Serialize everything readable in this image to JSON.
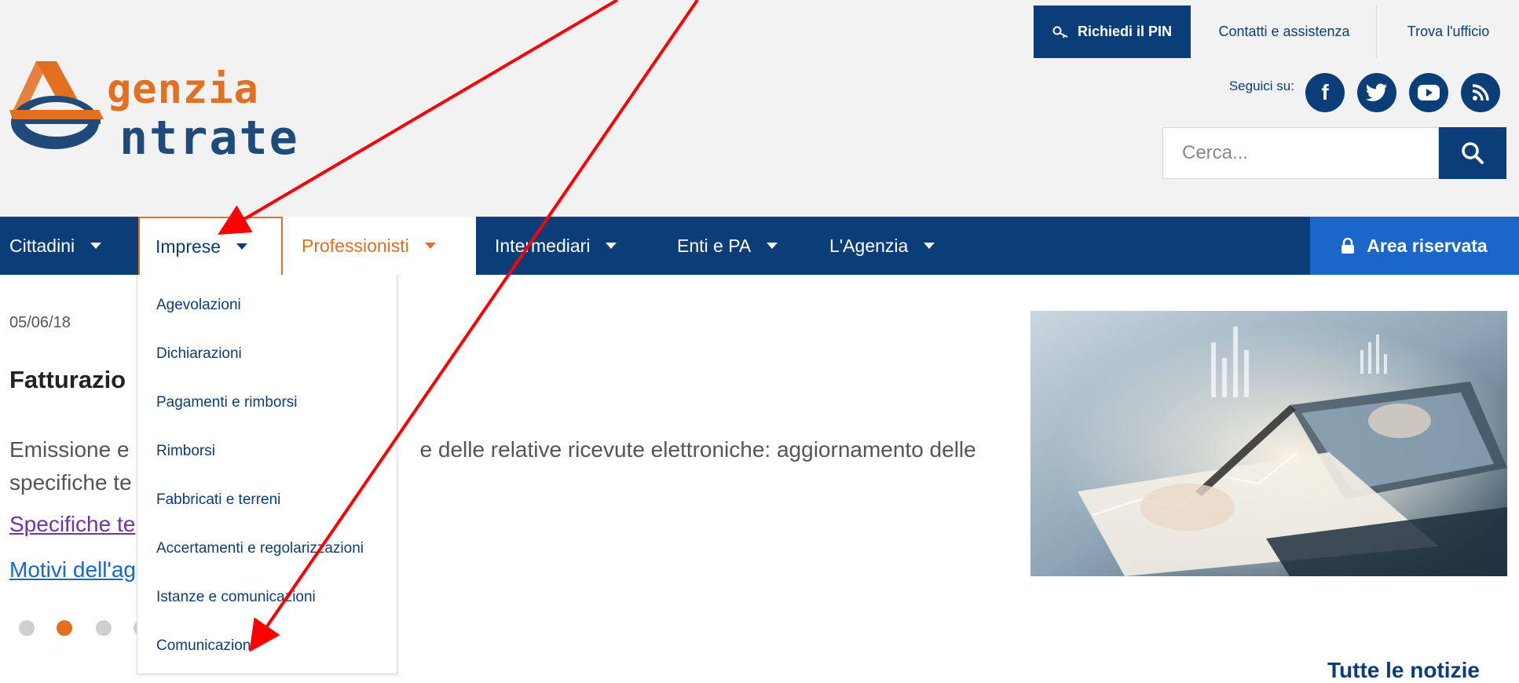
{
  "logo": {
    "line1": "genzia",
    "line2": "ntrate"
  },
  "top_bar": {
    "pin_label": "Richiedi il PIN",
    "contact_label": "Contatti e assistenza",
    "office_label": "Trova l'ufficio",
    "social_label": "Seguici su:",
    "social_icons": [
      "facebook-icon",
      "twitter-icon",
      "youtube-icon",
      "rss-icon"
    ]
  },
  "search": {
    "placeholder": "Cerca..."
  },
  "nav": {
    "items": [
      {
        "label": "Cittadini"
      },
      {
        "label": "Imprese"
      },
      {
        "label": "Professionisti"
      },
      {
        "label": "Intermediari"
      },
      {
        "label": "Enti e PA"
      },
      {
        "label": "L'Agenzia"
      }
    ],
    "area_label": "Area riservata"
  },
  "news": {
    "date": "05/06/18",
    "headline": "Fatturazio",
    "abstract_line1_start": "Emissione e",
    "abstract_line1_end": "e delle relative ricevute elettroniche: aggiornamento delle",
    "abstract_line2": "specifiche te",
    "link1": "Specifiche te",
    "link2": "Motivi dell'ag",
    "all_news": "Tutte le notizie"
  },
  "dropdown": {
    "items": [
      "Agevolazioni",
      "Dichiarazioni",
      "Pagamenti e rimborsi",
      "Rimborsi",
      "Fabbricati e terreni",
      "Accertamenti e regolarizzazioni",
      "Istanze e comunicazioni",
      "Comunicazioni"
    ]
  },
  "colors": {
    "primary": "#0b3d79",
    "accent": "#e36f21",
    "area": "#1a66c9",
    "annotation": "#ff0000"
  }
}
